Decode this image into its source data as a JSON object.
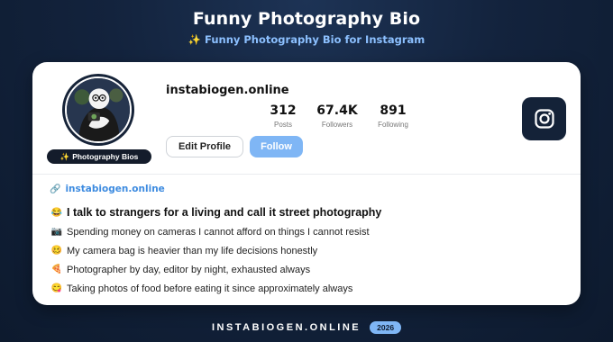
{
  "header": {
    "title": "Funny Photography Bio",
    "subtitle_icon": "sparkles-icon",
    "subtitle": "Funny Photography Bio for Instagram"
  },
  "profile": {
    "badge_icon": "sparkles-icon",
    "badge": "Photography Bios",
    "username": "instabiogen.online",
    "stats": [
      {
        "value": "312",
        "label": "Posts"
      },
      {
        "value": "67.4K",
        "label": "Followers"
      },
      {
        "value": "891",
        "label": "Following"
      }
    ],
    "edit_label": "Edit Profile",
    "follow_label": "Follow",
    "platform_icon": "instagram-icon"
  },
  "link": {
    "icon": "link-icon",
    "text": "instabiogen.online"
  },
  "bio_lines": [
    {
      "emoji": "😂",
      "text": "I talk to strangers for a living and call it street photography"
    },
    {
      "emoji": "📷",
      "text": "Spending money on cameras I cannot afford on things I cannot resist"
    },
    {
      "emoji": "🥴",
      "text": "My camera bag is heavier than my life decisions honestly"
    },
    {
      "emoji": "🍕",
      "text": "Photographer by day, editor by night, exhausted always"
    },
    {
      "emoji": "😋",
      "text": "Taking photos of food before eating it since approximately always"
    }
  ],
  "footer": {
    "brand": "INSTABIOGEN.ONLINE",
    "year": "2026"
  },
  "colors": {
    "accent": "#7fb6f5",
    "link": "#3d8be0",
    "background": "#13233d"
  }
}
